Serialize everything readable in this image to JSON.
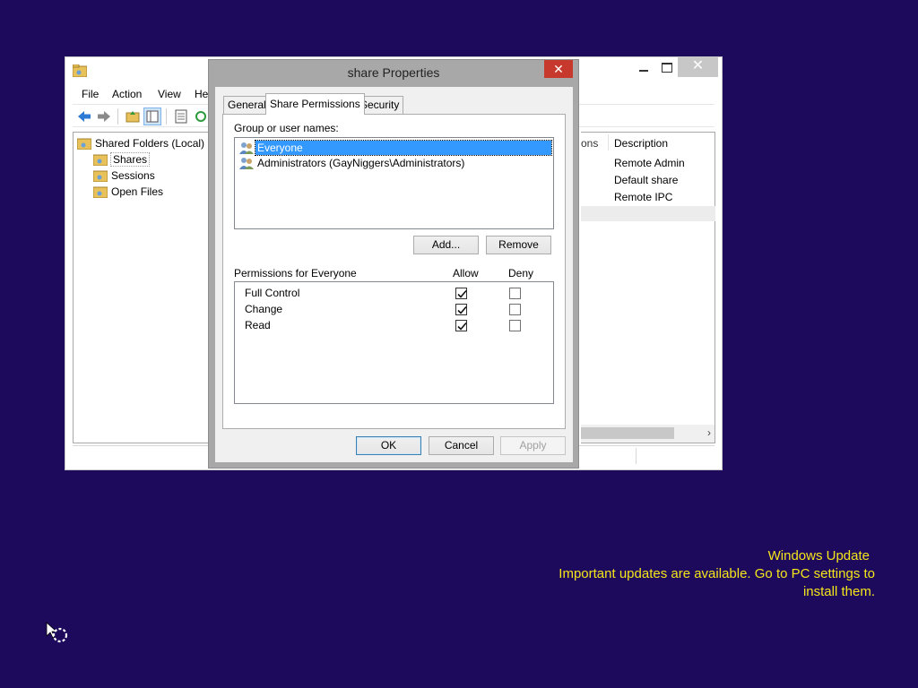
{
  "mmc": {
    "menu": [
      "File",
      "Action",
      "View",
      "He"
    ],
    "tree": {
      "root": "Shared Folders (Local)",
      "items": [
        "Shares",
        "Sessions",
        "Open Files"
      ]
    },
    "list": {
      "header_partial": "ons",
      "header_desc": "Description",
      "rows": [
        "Remote Admin",
        "Default share",
        "Remote IPC"
      ]
    }
  },
  "dialog": {
    "title": "share Properties",
    "close_glyph": "✕",
    "tabs": [
      "General",
      "Share Permissions",
      "Security"
    ],
    "active_tab": "Share Permissions",
    "group_label": "Group or user names:",
    "users": [
      {
        "name": "Everyone",
        "selected": true
      },
      {
        "name": "Administrators (GayNiggers\\Administrators)",
        "selected": false
      }
    ],
    "add_button": "Add...",
    "remove_button": "Remove",
    "permissions_label": "Permissions for Everyone",
    "allow_header": "Allow",
    "deny_header": "Deny",
    "permissions": [
      {
        "name": "Full Control",
        "allow": true,
        "deny": false
      },
      {
        "name": "Change",
        "allow": true,
        "deny": false
      },
      {
        "name": "Read",
        "allow": true,
        "deny": false
      }
    ],
    "ok_button": "OK",
    "cancel_button": "Cancel",
    "apply_button": "Apply"
  },
  "windows_update": {
    "title": "Windows Update",
    "line1": "Important updates are available. Go to PC settings to",
    "line2": "install them."
  },
  "colors": {
    "desktop": "#1d0a5c",
    "selection": "#3399ff",
    "close_red": "#c7392c",
    "update_text": "#f5e51a"
  },
  "icons": {
    "mmc_app": "shared-folders-icon",
    "back": "back-arrow-icon",
    "forward": "forward-arrow-icon",
    "user_group": "user-group-icon",
    "cursor": "busy-cursor-icon"
  }
}
